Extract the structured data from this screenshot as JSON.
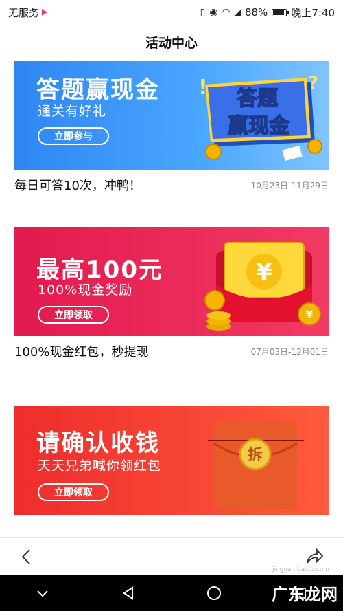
{
  "status": {
    "carrier": "无服务",
    "battery": "88%",
    "battery_level": 0.88,
    "time": "晚上7:40"
  },
  "header": {
    "title": "活动中心"
  },
  "cards": [
    {
      "banner_title": "答题赢现金",
      "banner_subtitle": "通关有好礼",
      "button": "立即参与",
      "art_text_1": "答题",
      "art_text_2": "赢现金",
      "caption": "每日可答10次，冲鸭！",
      "date": "10月23日-11月29日"
    },
    {
      "banner_title": "最高100元",
      "banner_subtitle": "100%现金奖励",
      "button": "立即领取",
      "art_symbol": "¥",
      "caption": "100%现金红包，秒提现",
      "date": "07月03日-12月01日"
    },
    {
      "banner_title": "请确认收钱",
      "banner_subtitle": "天天兄弟喊你领红包",
      "button": "立即领取",
      "art_symbol": "拆",
      "caption": "",
      "date": ""
    }
  ],
  "watermark": {
    "small": "jingyan.baidu.com",
    "large": "广东龙网"
  },
  "colors": {
    "blue": "#2f86f2",
    "crimson": "#e21a4f",
    "red": "#ee2c2c"
  }
}
